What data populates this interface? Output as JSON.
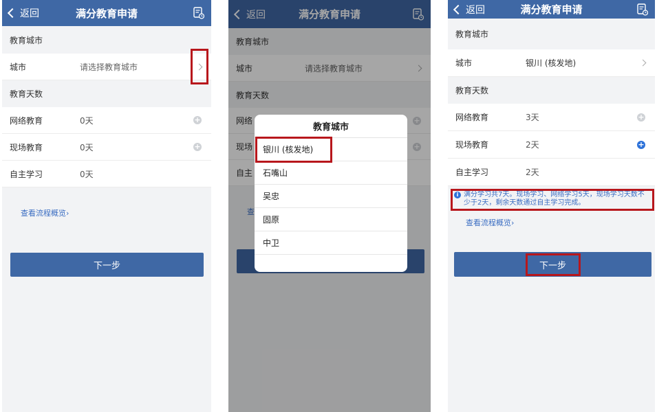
{
  "colors": {
    "navbar": "#3f68a5",
    "highlight": "#b8171c",
    "link": "#3b6dc2",
    "plus_active": "#2d72d9"
  },
  "icons": {
    "back": "chevron-left-icon",
    "doc": "document-clock-icon",
    "arrow": "chevron-right-icon",
    "plus": "plus-circle-icon",
    "info": "info-icon"
  },
  "screen1": {
    "back_label": "返回",
    "title": "满分教育申请",
    "section_city": "教育城市",
    "city_label": "城市",
    "city_placeholder": "请选择教育城市",
    "section_days": "教育天数",
    "rows": [
      {
        "label": "网络教育",
        "value": "0天"
      },
      {
        "label": "现场教育",
        "value": "0天"
      },
      {
        "label": "自主学习",
        "value": "0天"
      }
    ],
    "flow_link": "查看流程概览",
    "next_button": "下一步"
  },
  "screen2": {
    "back_label": "返回",
    "title": "满分教育申请",
    "section_city": "教育城市",
    "city_label": "城市",
    "city_placeholder": "请选择教育城市",
    "section_days": "教育天数",
    "row_online_partial": "网络",
    "row_onsite_partial": "现场",
    "row_self_partial": "自主",
    "flow_link_partial": "查",
    "dialog": {
      "title": "教育城市",
      "options": [
        "银川 (核发地)",
        "石嘴山",
        "吴忠",
        "固原",
        "中卫"
      ]
    }
  },
  "screen3": {
    "back_label": "返回",
    "title": "满分教育申请",
    "section_city": "教育城市",
    "city_label": "城市",
    "city_value": "银川 (核发地)",
    "section_days": "教育天数",
    "rows": [
      {
        "label": "网络教育",
        "value": "3天"
      },
      {
        "label": "现场教育",
        "value": "2天"
      },
      {
        "label": "自主学习",
        "value": "2天"
      }
    ],
    "notice": "满分学习共7天。现场学习、网络学习5天，现场学习天数不少于2天，剩余天数通过自主学习完成。",
    "flow_link": "查看流程概览",
    "next_button": "下一步"
  }
}
